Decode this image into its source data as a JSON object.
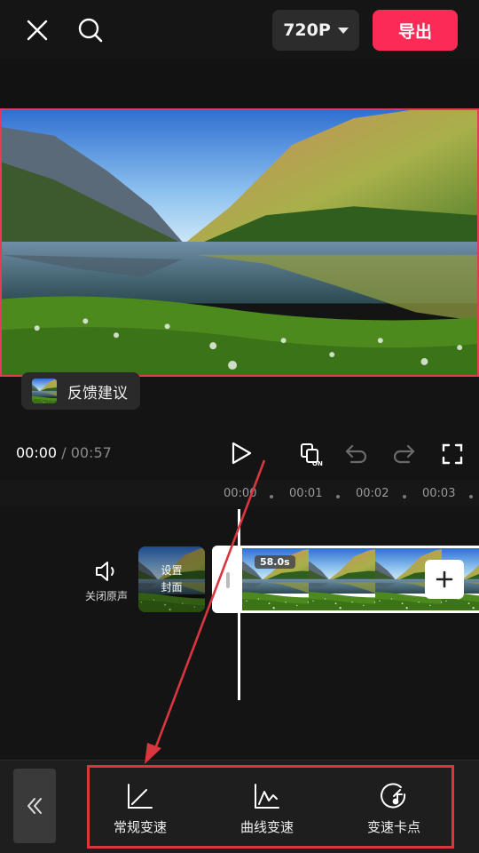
{
  "header": {
    "resolution": "720P",
    "export_label": "导出",
    "export_color": "#fc2b55",
    "icons": [
      "close-icon",
      "search-icon",
      "caret-down-icon"
    ]
  },
  "feedback": {
    "label": "反馈建议"
  },
  "playback": {
    "current_time": "00:00",
    "separator": "/",
    "total_time": "00:57",
    "icons": [
      "play-icon",
      "lock-on-icon",
      "undo-icon",
      "redo-icon",
      "fullscreen-icon"
    ]
  },
  "ruler": {
    "ticks": [
      "00:00",
      "00:01",
      "00:02",
      "00:03"
    ]
  },
  "timeline": {
    "mute_label": "关闭原声",
    "cover_line1": "设置",
    "cover_line2": "封面",
    "clip_duration": "58.0s"
  },
  "toolbar": {
    "tools": [
      {
        "label": "常规变速",
        "icon": "linear-speed-icon"
      },
      {
        "label": "曲线变速",
        "icon": "curve-speed-icon"
      },
      {
        "label": "变速卡点",
        "icon": "speed-beat-icon"
      }
    ],
    "collapse_icon": "double-chevron-left-icon"
  },
  "annotation": {
    "color": "#d9363e"
  }
}
